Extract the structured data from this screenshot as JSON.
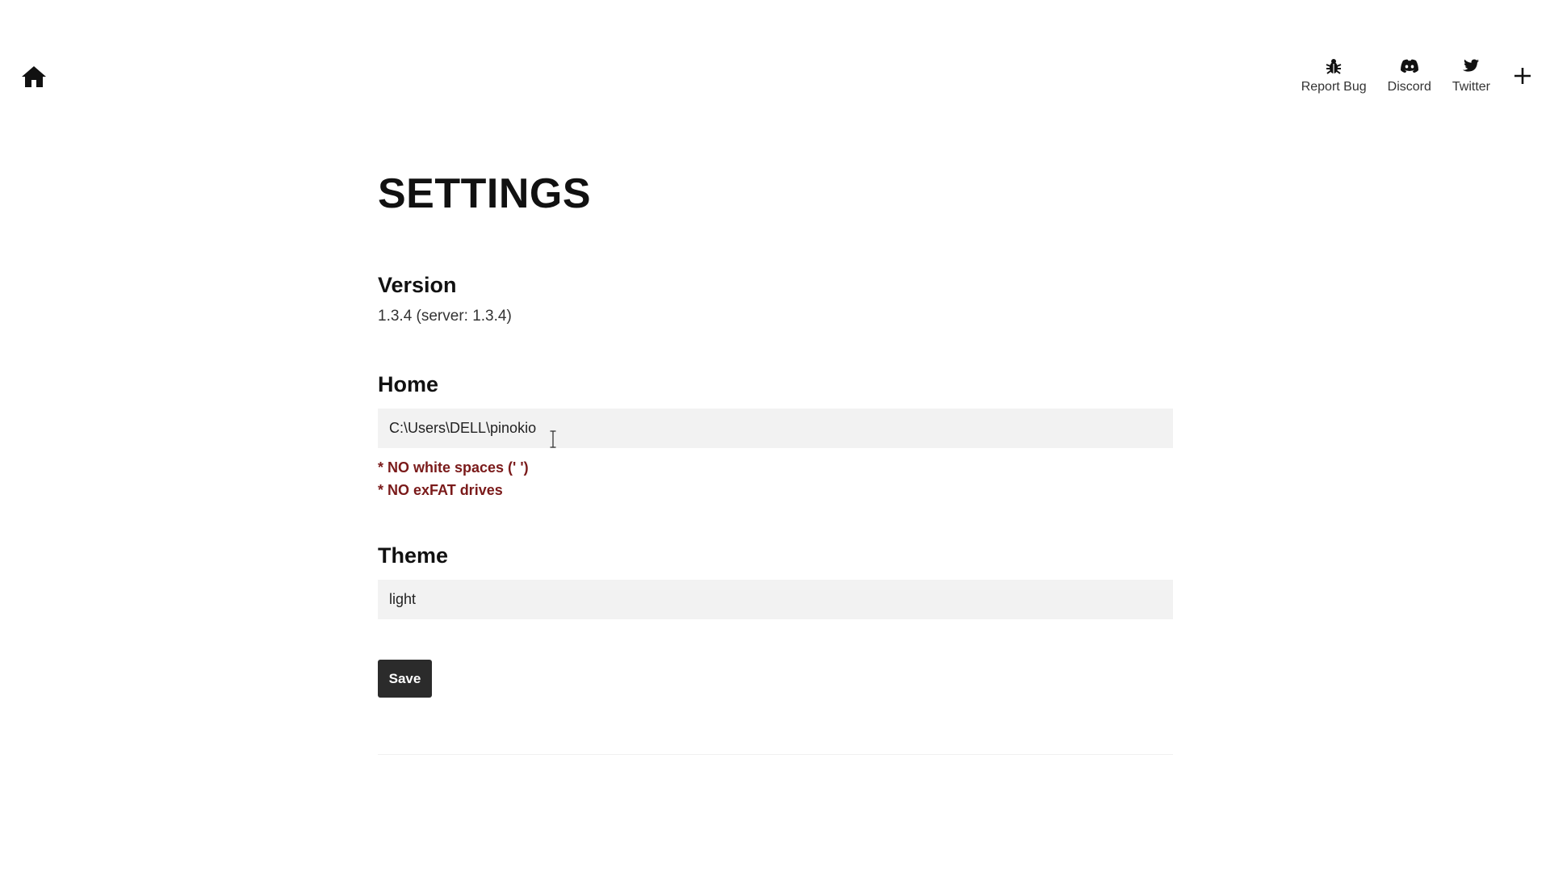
{
  "nav": {
    "home_icon": "home-icon",
    "items": [
      {
        "label": "Report Bug",
        "icon": "bug-icon"
      },
      {
        "label": "Discord",
        "icon": "discord-icon"
      },
      {
        "label": "Twitter",
        "icon": "twitter-icon"
      }
    ],
    "plus_icon": "plus-icon"
  },
  "page": {
    "title": "SETTINGS"
  },
  "version": {
    "label": "Version",
    "value": "1.3.4 (server: 1.3.4)"
  },
  "home": {
    "label": "Home",
    "value": "C:\\Users\\DELL\\pinokio",
    "notes": [
      "* NO white spaces (' ')",
      "* NO exFAT drives"
    ]
  },
  "theme": {
    "label": "Theme",
    "value": "light"
  },
  "actions": {
    "save_label": "Save"
  },
  "colors": {
    "note": "#7a1a1a",
    "button_bg": "#2b2b2b",
    "field_bg": "#f2f2f2"
  }
}
